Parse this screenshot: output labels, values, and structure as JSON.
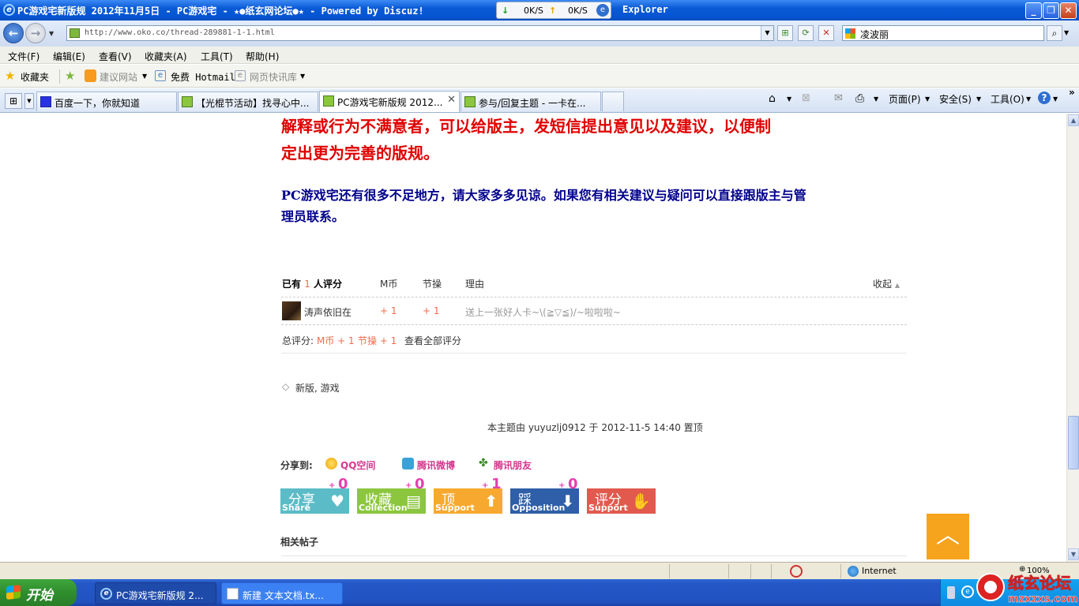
{
  "window": {
    "title": "PC游戏宅新版规 2012年11月5日 - PC游戏宅 - ★●纸玄网论坛●★ - Powered by Discuz!",
    "title_suffix": "Explorer"
  },
  "netspeed": {
    "down": "0K/S",
    "up": "0K/S"
  },
  "address": {
    "url": "http://www.oko.co/thread-289881-1-1.html"
  },
  "search": {
    "value": "凌波丽"
  },
  "menu": [
    "文件(F)",
    "编辑(E)",
    "查看(V)",
    "收藏夹(A)",
    "工具(T)",
    "帮助(H)"
  ],
  "favorites": {
    "label": "收藏夹",
    "items": [
      "建议网站",
      "免费 Hotmail",
      "网页快讯库"
    ]
  },
  "tabs": [
    {
      "label": "百度一下，你就知道"
    },
    {
      "label": "【光棍节活动】找寻心中..."
    },
    {
      "label": "PC游戏宅新版规 2012..."
    },
    {
      "label": "参与/回复主题 - 一卡在..."
    }
  ],
  "commandbar": {
    "page": "页面(P)",
    "safety": "安全(S)",
    "tools": "工具(O)"
  },
  "post": {
    "red_line1": "解释或行为不满意者，可以给版主，发短信提出意见以及建议，以便制",
    "red_line2": "定出更为完善的版规。",
    "blue_line1": "PC游戏宅还有很多不足地方，请大家多多见谅。如果您有相关建议与疑问可以直接跟版主与管",
    "blue_line2": "理员联系。"
  },
  "rating": {
    "header_prefix": "已有",
    "count": "1",
    "header_suffix": "人评分",
    "col_m": "M币",
    "col_j": "节操",
    "col_reason": "理由",
    "collapse": "收起",
    "row": {
      "user": "涛声依旧在",
      "m": "+ 1",
      "j": "+ 1",
      "reason": "送上一张好人卡~\\(≧▽≦)/~啦啦啦~"
    },
    "total_label": "总评分:",
    "total_m": "M币 + 1",
    "total_j": "节操 + 1",
    "view_all": "查看全部评分"
  },
  "tags": {
    "text": "新版, 游戏"
  },
  "pinned": {
    "text": "本主题由 yuyuzlj0912 于 2012-11-5 14:40 置顶"
  },
  "share": {
    "label": "分享到:",
    "qzone": "QQ空间",
    "weibo": "腾讯微博",
    "pengyou": "腾讯朋友"
  },
  "actions": [
    {
      "cn": "分享",
      "en": "Share",
      "count": "0",
      "color": "#5bbcc7"
    },
    {
      "cn": "收藏",
      "en": "Collection",
      "count": "0",
      "color": "#8cc63f"
    },
    {
      "cn": "顶",
      "en": "Support",
      "count": "1",
      "color": "#f7a92f"
    },
    {
      "cn": "踩",
      "en": "Opposition",
      "count": "0",
      "color": "#2f5fa8"
    },
    {
      "cn": "评分",
      "en": "Support",
      "count": "",
      "color": "#e15a4d"
    }
  ],
  "related": {
    "title": "相关帖子"
  },
  "status": {
    "zone": "Internet",
    "zoom": "100%"
  },
  "taskbar": {
    "start": "开始",
    "tasks": [
      "PC游戏宅新版规 2...",
      "新建 文本文档.tx..."
    ]
  },
  "watermark": {
    "name": "纸玄论坛",
    "site": "mzxzxs.com"
  }
}
